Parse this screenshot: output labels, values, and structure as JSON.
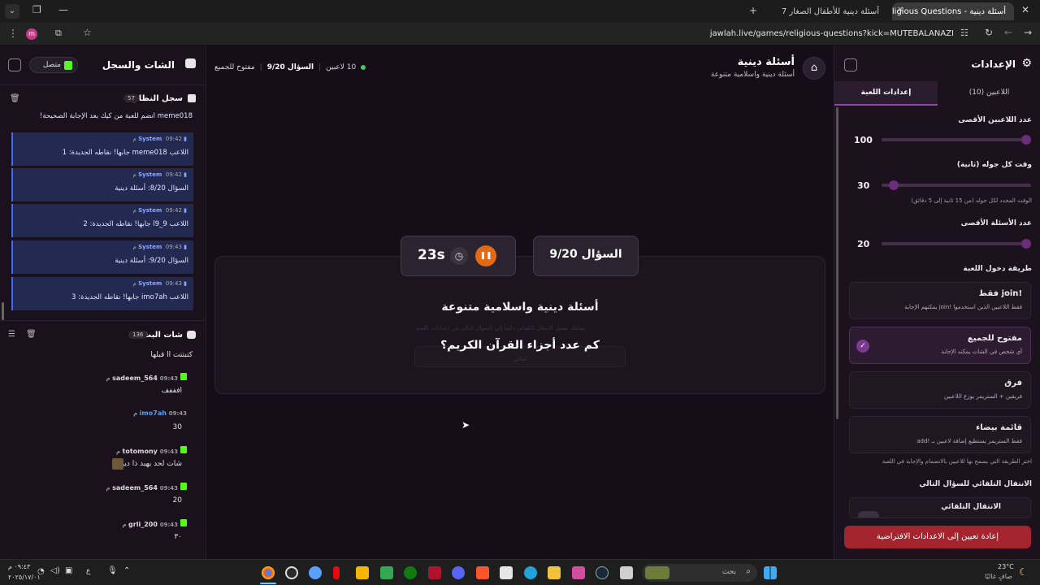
{
  "browser": {
    "tabs": [
      {
        "label": "أسئلة دينية - Religious Questions",
        "active": true
      },
      {
        "label": "أسئلة دينية للأطفال الصغار 7 س...",
        "active": false
      }
    ],
    "url": "jawlah.live/games/religious-questions?kick=MUTEBALANAZI",
    "profile_initial": "m"
  },
  "left": {
    "title": "الشات والسجل",
    "status": "متصل",
    "system_log": {
      "title": "سجل النظام",
      "count": "57",
      "first_msg": "meme018 انضم للعبة من كيك بعد الإجابة الصحيحة!",
      "messages": [
        {
          "user": "System",
          "time": "09:42 م",
          "text": "اللاعب meme018 جابها! نقاطه الجديدة: 1"
        },
        {
          "user": "System",
          "time": "09:42 م",
          "text": "السؤال 8/20: أسئلة دينية"
        },
        {
          "user": "System",
          "time": "09:42 م",
          "text": "اللاعب 9_l9 جابها! نقاطه الجديدة: 2"
        },
        {
          "user": "System",
          "time": "09:43 م",
          "text": "السؤال 9/20: أسئلة دينية"
        },
        {
          "user": "System",
          "time": "09:43 م",
          "text": "اللاعب imo7ah جابها! نقاطه الجديدة: 3"
        }
      ]
    },
    "stream_chat": {
      "title": "شات البث",
      "count": "136",
      "first_msg": "كتبتتت اا قبلها",
      "messages": [
        {
          "user": "sadeem_564",
          "time": "09:43 م",
          "text": "افففف"
        },
        {
          "user": "imo7ah",
          "time": "09:43 م",
          "text": "30"
        },
        {
          "user": "totomony",
          "time": "09:43 م",
          "text": "شات لحد يهبد ذا دين"
        },
        {
          "user": "sadeem_564",
          "time": "09:43 م",
          "text": "20"
        },
        {
          "user": "grli_200",
          "time": "09:43 م",
          "text": "٣٠"
        }
      ]
    }
  },
  "main": {
    "game_title": "أسئلة دينية",
    "game_subtitle": "أسئلة دينية واسلامية متنوعة",
    "players": "10 لاعبين",
    "question_progress": "السؤال 9/20",
    "mode": "مفتوح للجميع",
    "timer": "23s",
    "question_label": "السؤال 9/20",
    "category": "أسئلة دينية واسلامية متنوعة",
    "ghost_hint": "يمكنك تفعيل الانتقال التلقائي دائماً إلى السؤال التالي من إعدادات اللعبة",
    "ghost_button": "التالي",
    "question": "كم عدد أجزاء القرآن الكريم؟"
  },
  "right": {
    "title": "الإعدادات",
    "tabs": [
      "إعدادات اللعبة",
      "اللاعبين (10)"
    ],
    "max_players": {
      "label": "عدد اللاعبين الأقصى",
      "value": "100",
      "level": 0.0
    },
    "round_time": {
      "label": "وقت كل جوله (ثانية)",
      "value": "30",
      "hint": "الوقت المحدد لكل جوله (من 15 ثانية إلى 5 دقائق)",
      "level": 0.95
    },
    "max_questions": {
      "label": "عدد الأسئلة الأقصى",
      "value": "20",
      "level": 0.0
    },
    "join_method_label": "طريقة دخول اللعبة",
    "join_methods": [
      {
        "title": "!join فقط",
        "desc": "فقط اللاعبين الذين استخدموا !join يمكنهم الإجابة",
        "selected": false
      },
      {
        "title": "مفتوح للجميع",
        "desc": "أي شخص في الشات يمكنه الإجابة",
        "selected": true
      },
      {
        "title": "فرق",
        "desc": "فريقين + الستريمر يوزع اللاعبين",
        "selected": false
      },
      {
        "title": "قائمة بيضاء",
        "desc": "فقط الستريمر يستطيع إضافة لاعبين بـ !add",
        "selected": false
      }
    ],
    "join_hint": "اختر الطريقة التي يسمح بها للاعبين بالانضمام والإجابة في اللعبة",
    "auto_next_label": "الانتقال التلقائي للسؤال التالي",
    "auto_next_card": "الانتقال التلقائي",
    "reset_button": "إعادة تعيين إلى الاعدادات الافتراضية"
  },
  "taskbar": {
    "search_placeholder": "بحث",
    "weather_temp": "23°C",
    "weather_desc": "صافٍ غالبًا",
    "time": "٠٩:٤٣ م",
    "date": "٢٠٢٥/١٧/٠١",
    "lang": "ع"
  },
  "colors": {
    "accent_purple": "#6a2d7a",
    "timer_orange": "#e36a12",
    "kick_green": "#53fc18",
    "system_blue": "#222a52",
    "reset_red": "#a3242c"
  }
}
